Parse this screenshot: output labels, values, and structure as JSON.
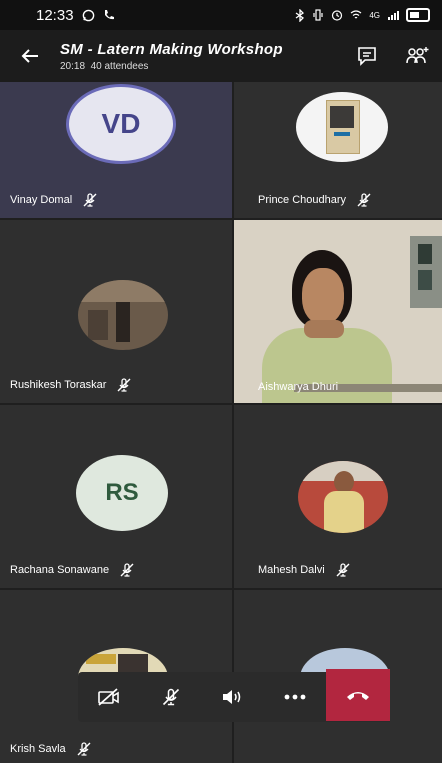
{
  "status_bar": {
    "time": "12:33",
    "signal_text": "4G"
  },
  "header": {
    "title": "SM - Latern Making Workshop",
    "duration": "20:18",
    "attendees": "40 attendees"
  },
  "participants": [
    {
      "name": "Vinay Domal",
      "initials": "VD",
      "mic_muted": true
    },
    {
      "name": "Prince Choudhary",
      "mic_muted": true
    },
    {
      "name": "Rushikesh Toraskar",
      "mic_muted": true
    },
    {
      "name": "Aishwarya Dhuri",
      "video_on": true
    },
    {
      "name": "Rachana Sonawane",
      "initials": "RS",
      "mic_muted": true
    },
    {
      "name": "Mahesh Dalvi",
      "mic_muted": true
    },
    {
      "name": "Krish Savla",
      "mic_muted": true
    }
  ],
  "controls": {
    "video": "camera-off-icon",
    "mic": "mic-off-icon",
    "speaker": "speaker-icon",
    "more": "more-icon",
    "end_call": "hang-up-icon"
  },
  "colors": {
    "end_call": "#b2263f",
    "active_tile": "#3b3a4f",
    "vd_avatar_bg": "#e6e6f0",
    "vd_avatar_ring": "#6b6bb8",
    "rs_avatar_bg": "#dfe8de",
    "rs_avatar_text": "#2f5a3d"
  }
}
